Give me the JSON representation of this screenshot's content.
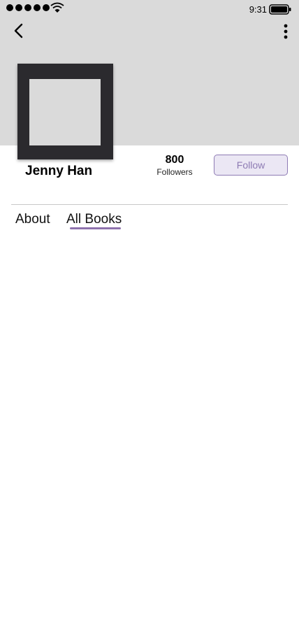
{
  "status_bar": {
    "time": "9:31",
    "signal_icon": "signal-dots-icon",
    "wifi_icon": "wifi-icon",
    "battery_icon": "battery-full-icon"
  },
  "nav": {
    "back_icon": "chevron-left-icon",
    "more_icon": "more-vertical-icon"
  },
  "profile": {
    "name": "Jenny Han",
    "followers_count": "800",
    "followers_label": "Followers",
    "follow_label": "Follow"
  },
  "tabs": [
    {
      "label": "About",
      "active": false
    },
    {
      "label": "All Books",
      "active": true
    }
  ],
  "colors": {
    "header_bg": "#dadada",
    "avatar_frame": "#2b2a2e",
    "accent": "#8e72ad",
    "follow_bg": "#ebe7f4"
  }
}
